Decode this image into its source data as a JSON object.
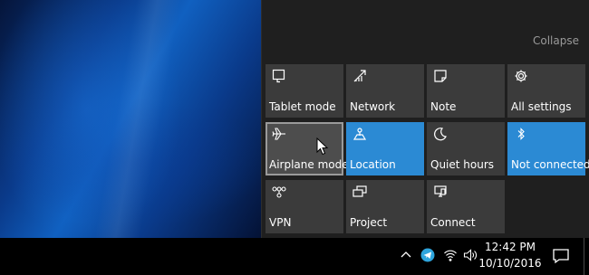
{
  "action_center": {
    "collapse_label": "Collapse",
    "tiles": [
      {
        "label": "Tablet mode",
        "icon": "tablet-mode-icon",
        "state": "off"
      },
      {
        "label": "Network",
        "icon": "network-icon",
        "state": "off"
      },
      {
        "label": "Note",
        "icon": "note-icon",
        "state": "off"
      },
      {
        "label": "All settings",
        "icon": "settings-gear-icon",
        "state": "off"
      },
      {
        "label": "Airplane mode",
        "icon": "airplane-icon",
        "state": "hover"
      },
      {
        "label": "Location",
        "icon": "location-icon",
        "state": "on"
      },
      {
        "label": "Quiet hours",
        "icon": "moon-icon",
        "state": "off"
      },
      {
        "label": "Not connected",
        "icon": "bluetooth-icon",
        "state": "on"
      },
      {
        "label": "VPN",
        "icon": "vpn-icon",
        "state": "off"
      },
      {
        "label": "Project",
        "icon": "project-icon",
        "state": "off"
      },
      {
        "label": "Connect",
        "icon": "connect-icon",
        "state": "off"
      }
    ]
  },
  "taskbar": {
    "tray_icons": [
      "chevron-up-icon",
      "telegram-icon",
      "wifi-icon",
      "volume-icon"
    ],
    "time": "12:42 PM",
    "date": "10/10/2016"
  },
  "colors": {
    "accent": "#2b8ad4",
    "tile": "#3b3b3b",
    "panel": "#1f1f1f"
  }
}
